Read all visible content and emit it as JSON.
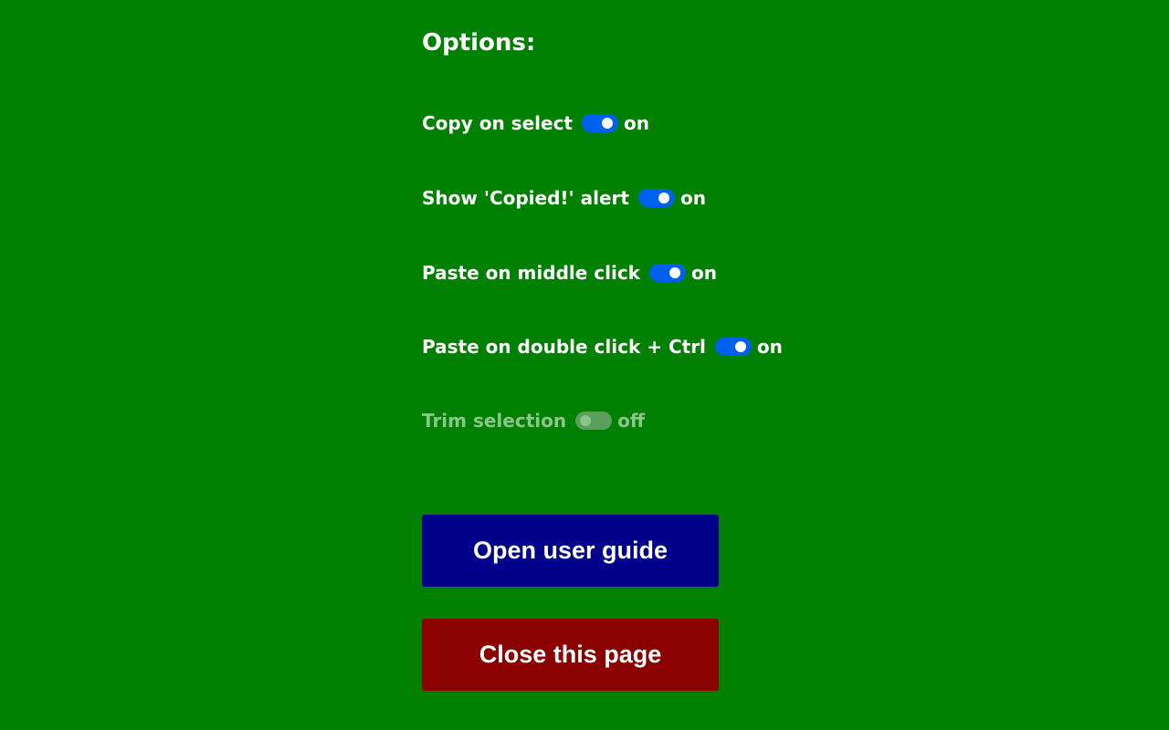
{
  "heading": "Options:",
  "colors": {
    "background": "#008000",
    "toggle_on": "#0060f0",
    "toggle_off": "#a8b8a8",
    "guide_button": "#00008b",
    "close_button": "#8b0000"
  },
  "options": [
    {
      "label": "Copy on select",
      "state": "on",
      "enabled": true
    },
    {
      "label": "Show 'Copied!' alert",
      "state": "on",
      "enabled": true
    },
    {
      "label": "Paste on middle click",
      "state": "on",
      "enabled": true
    },
    {
      "label": "Paste on double click + Ctrl",
      "state": "on",
      "enabled": true
    },
    {
      "label": "Trim selection",
      "state": "off",
      "enabled": false
    }
  ],
  "buttons": {
    "guide_label": "Open user guide",
    "close_label": "Close this page"
  }
}
